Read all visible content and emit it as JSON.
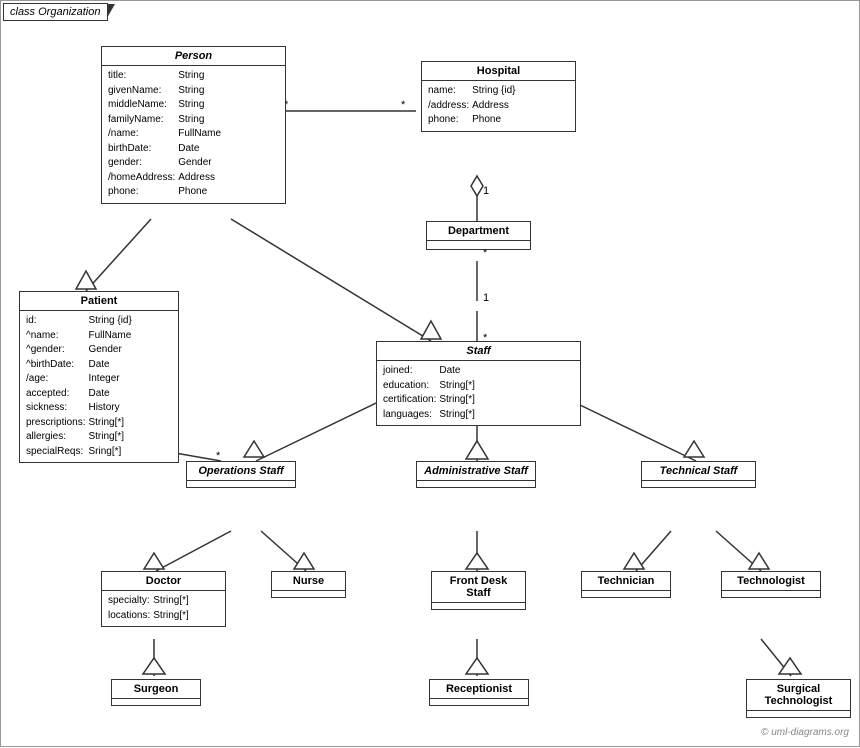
{
  "diagram": {
    "title": "class Organization",
    "watermark": "© uml-diagrams.org",
    "classes": {
      "person": {
        "name": "Person",
        "italic": true,
        "attributes": [
          {
            "name": "title:",
            "type": "String"
          },
          {
            "name": "givenName:",
            "type": "String"
          },
          {
            "name": "middleName:",
            "type": "String"
          },
          {
            "name": "familyName:",
            "type": "String"
          },
          {
            "name": "/name:",
            "type": "FullName"
          },
          {
            "name": "birthDate:",
            "type": "Date"
          },
          {
            "name": "gender:",
            "type": "Gender"
          },
          {
            "name": "/homeAddress:",
            "type": "Address"
          },
          {
            "name": "phone:",
            "type": "Phone"
          }
        ]
      },
      "hospital": {
        "name": "Hospital",
        "attributes": [
          {
            "name": "name:",
            "type": "String {id}"
          },
          {
            "name": "/address:",
            "type": "Address"
          },
          {
            "name": "phone:",
            "type": "Phone"
          }
        ]
      },
      "department": {
        "name": "Department",
        "attributes": []
      },
      "staff": {
        "name": "Staff",
        "italic": true,
        "attributes": [
          {
            "name": "joined:",
            "type": "Date"
          },
          {
            "name": "education:",
            "type": "String[*]"
          },
          {
            "name": "certification:",
            "type": "String[*]"
          },
          {
            "name": "languages:",
            "type": "String[*]"
          }
        ]
      },
      "patient": {
        "name": "Patient",
        "attributes": [
          {
            "name": "id:",
            "type": "String {id}"
          },
          {
            "name": "^name:",
            "type": "FullName"
          },
          {
            "name": "^gender:",
            "type": "Gender"
          },
          {
            "name": "^birthDate:",
            "type": "Date"
          },
          {
            "name": "/age:",
            "type": "Integer"
          },
          {
            "name": "accepted:",
            "type": "Date"
          },
          {
            "name": "sickness:",
            "type": "History"
          },
          {
            "name": "prescriptions:",
            "type": "String[*]"
          },
          {
            "name": "allergies:",
            "type": "String[*]"
          },
          {
            "name": "specialReqs:",
            "type": "Sring[*]"
          }
        ]
      },
      "operations_staff": {
        "name": "Operations Staff",
        "italic": true,
        "attributes": []
      },
      "administrative_staff": {
        "name": "Administrative Staff",
        "italic": true,
        "attributes": []
      },
      "technical_staff": {
        "name": "Technical Staff",
        "italic": true,
        "attributes": []
      },
      "doctor": {
        "name": "Doctor",
        "attributes": [
          {
            "name": "specialty:",
            "type": "String[*]"
          },
          {
            "name": "locations:",
            "type": "String[*]"
          }
        ]
      },
      "nurse": {
        "name": "Nurse",
        "attributes": []
      },
      "front_desk_staff": {
        "name": "Front Desk Staff",
        "attributes": []
      },
      "technician": {
        "name": "Technician",
        "attributes": []
      },
      "technologist": {
        "name": "Technologist",
        "attributes": []
      },
      "surgeon": {
        "name": "Surgeon",
        "attributes": []
      },
      "receptionist": {
        "name": "Receptionist",
        "attributes": []
      },
      "surgical_technologist": {
        "name": "Surgical Technologist",
        "attributes": []
      }
    }
  }
}
